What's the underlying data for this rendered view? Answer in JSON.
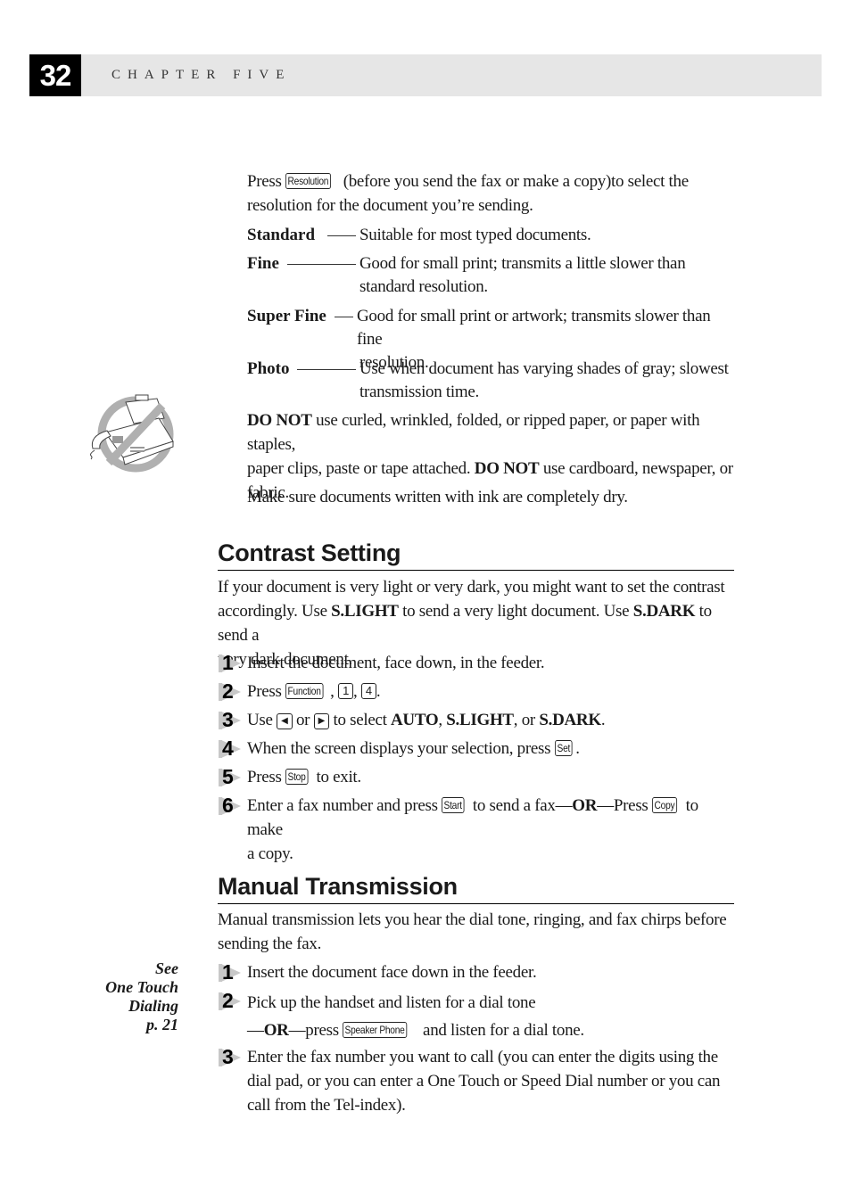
{
  "header": {
    "page_number": "32",
    "chapter": "CHAPTER FIVE"
  },
  "resolution": {
    "intro_pre": "Press",
    "intro_key": "Resolution",
    "intro_post_line1": "(before you send the fax or make a copy)to select the",
    "intro_line2": "resolution for the document you’re sending.",
    "options": [
      {
        "term": "Standard",
        "line1": "Suitable for most typed documents.",
        "line2": ""
      },
      {
        "term": "Fine",
        "line1": "Good for small print; transmits a little slower than",
        "line2": "standard resolution."
      },
      {
        "term": "Super Fine",
        "line1": "Good for small print or artwork; transmits slower than fine",
        "line2": "resolution."
      },
      {
        "term": "Photo",
        "line1": "Use when document has varying shades of gray; slowest",
        "line2": "transmission time."
      }
    ],
    "warning": {
      "bold1": "DO NOT",
      "text1": " use curled, wrinkled, folded, or ripped paper, or paper with staples,",
      "text2": "paper clips, paste or tape attached. ",
      "bold2": "DO NOT",
      "text3": " use cardboard, newspaper, or",
      "text4": "fabric."
    },
    "ink_note": "Make sure documents written with ink are completely dry.",
    "icon": "no-fax-icon"
  },
  "contrast": {
    "title": "Contrast Setting",
    "intro_line1": "If your document is very light or very dark, you might want to set the contrast",
    "intro_line2_a": "accordingly. Use ",
    "intro_line2_b1": "S.LIGHT",
    "intro_line2_c": " to send a very light document. Use ",
    "intro_line2_b2": "S.DARK",
    "intro_line2_d": " to send a",
    "intro_line3": "very dark document.",
    "steps": [
      {
        "n": "1",
        "text": "Insert the document, face down, in the feeder."
      },
      {
        "n": "2",
        "pre": "Press ",
        "keys": [
          "Function",
          "1",
          "4"
        ]
      },
      {
        "n": "3",
        "pre": "Use ",
        "left_key": "◀",
        "mid": " or ",
        "right_key": "▶",
        "post": " to select ",
        "opt1": "AUTO",
        "opt2": "S.LIGHT",
        "opt3": "S.DARK"
      },
      {
        "n": "4",
        "pre": "When the screen displays your selection, press ",
        "key": "Set"
      },
      {
        "n": "5",
        "pre": "Press ",
        "key": "Stop",
        "post": " to exit."
      },
      {
        "n": "6",
        "pre": "Enter a fax number and press ",
        "key1": "Start",
        "mid": " to send a fax—",
        "or": "OR",
        "mid2": "—Press ",
        "key2": "Copy",
        "post": " to make",
        "line2": "a copy."
      }
    ]
  },
  "manual": {
    "title": "Manual Transmission",
    "intro_line1": "Manual transmission lets you hear the dial tone, ringing, and fax chirps before",
    "intro_line2": "sending the fax.",
    "sidenote": [
      "See",
      "One Touch",
      "Dialing",
      "p. 21"
    ],
    "steps": [
      {
        "n": "1",
        "text": "Insert the document face down in the feeder."
      },
      {
        "n": "2",
        "text": "Pick up the handset and listen for a dial tone",
        "or_pre": "—",
        "or": "OR",
        "or_mid": "—press ",
        "key": "Speaker Phone",
        "post": " and listen for a dial tone."
      },
      {
        "n": "3",
        "line1": "Enter the fax number you want to call (you can enter the digits using the",
        "line2": "dial pad, or you can enter a One Touch or Speed Dial number or you can",
        "line3": "call from the Tel-index)."
      }
    ]
  }
}
